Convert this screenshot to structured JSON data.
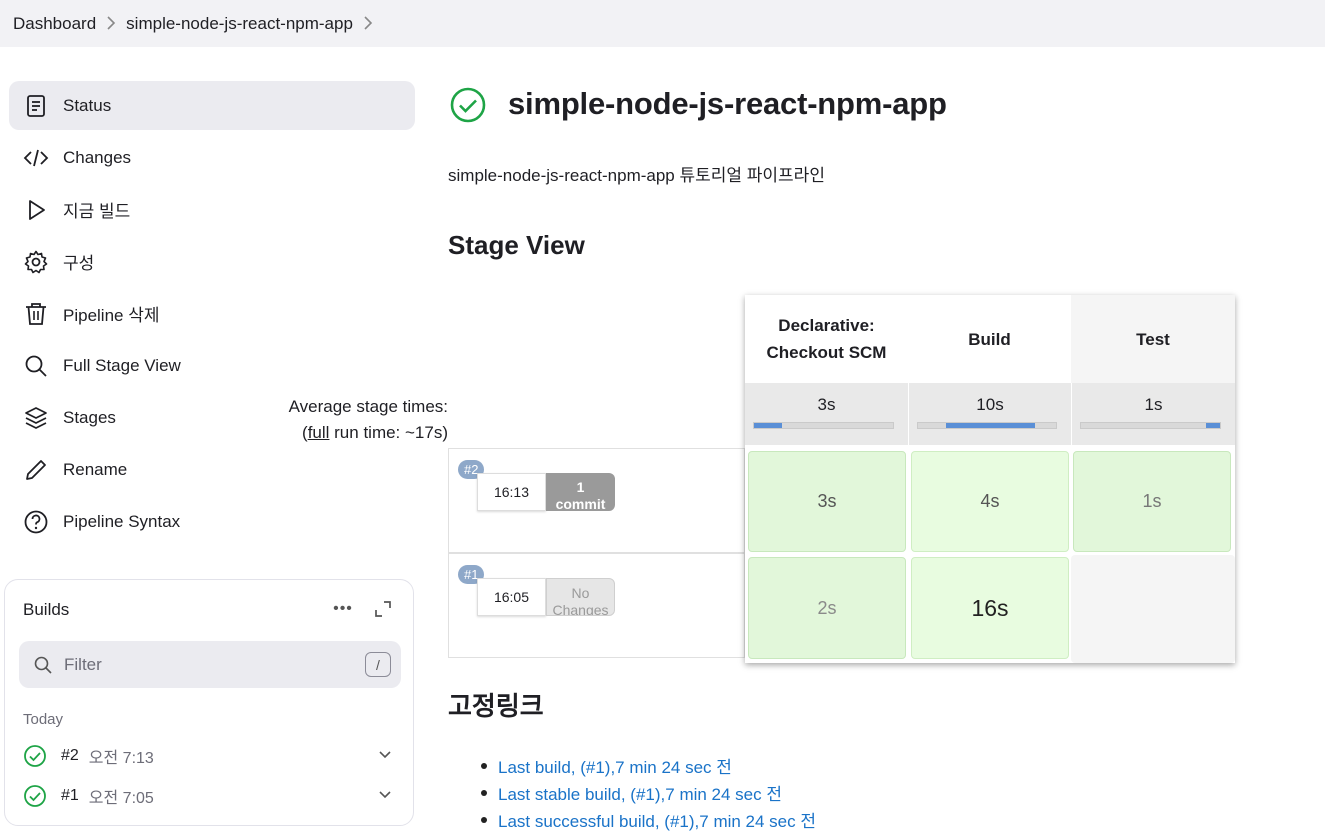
{
  "breadcrumb": {
    "items": [
      "Dashboard",
      "simple-node-js-react-npm-app"
    ]
  },
  "sidebar": {
    "items": [
      {
        "label": "Status",
        "icon": "document-icon",
        "active": true
      },
      {
        "label": "Changes",
        "icon": "code-icon"
      },
      {
        "label": "지금 빌드",
        "icon": "play-icon"
      },
      {
        "label": "구성",
        "icon": "gear-icon"
      },
      {
        "label": "Pipeline 삭제",
        "icon": "trash-icon"
      },
      {
        "label": "Full Stage View",
        "icon": "search-icon"
      },
      {
        "label": "Stages",
        "icon": "layers-icon"
      },
      {
        "label": "Rename",
        "icon": "pencil-icon"
      },
      {
        "label": "Pipeline Syntax",
        "icon": "help-icon"
      }
    ]
  },
  "builds": {
    "title": "Builds",
    "more": "•••",
    "filter_placeholder": "Filter",
    "filter_shortcut": "/",
    "group_label": "Today",
    "rows": [
      {
        "number": "#2",
        "time": "오전 7:13",
        "status": "success"
      },
      {
        "number": "#1",
        "time": "오전 7:05",
        "status": "success"
      }
    ]
  },
  "main": {
    "title": "simple-node-js-react-npm-app",
    "description": "simple-node-js-react-npm-app 튜토리얼 파이프라인",
    "stage_view_heading": "Stage View",
    "permalinks_heading": "고정링크",
    "status_color": "#1ea446",
    "link_color": "#1a73c8"
  },
  "stage_view": {
    "avg_label_line1": "Average stage times:",
    "avg_label_prefix": "(",
    "avg_label_full": "full",
    "avg_label_suffix": " run time: ~17s)",
    "stages": [
      {
        "name_line1": "Declarative:",
        "name_line2": "Checkout SCM",
        "avg": "3s",
        "avg_fraction": 0.2
      },
      {
        "name_line1": "Build",
        "name_line2": "",
        "avg": "10s",
        "avg_fraction": 0.85
      },
      {
        "name_line1": "Test",
        "name_line2": "",
        "avg": "1s",
        "avg_fraction": 0.1
      }
    ],
    "runs": [
      {
        "badge": "#2",
        "time": "16:13",
        "changes_line1": "1",
        "changes_line2": "commit",
        "has_changes": true,
        "durations": [
          "3s",
          "4s",
          "1s"
        ]
      },
      {
        "badge": "#1",
        "time": "16:05",
        "changes_line1": "No",
        "changes_line2": "Changes",
        "has_changes": false,
        "durations": [
          "2s",
          "16s",
          ""
        ]
      }
    ]
  },
  "permalinks": [
    "Last build, (#1),7 min 24 sec 전",
    "Last stable build, (#1),7 min 24 sec 전",
    "Last successful build, (#1),7 min 24 sec 전"
  ]
}
